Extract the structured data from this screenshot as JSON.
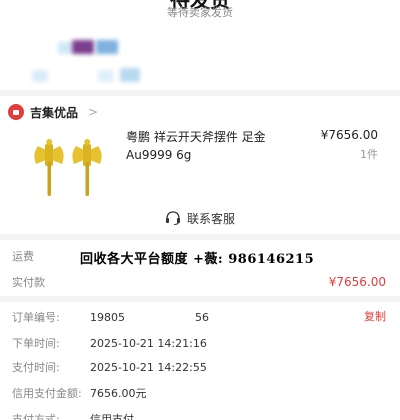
{
  "status": {
    "title": "待发货",
    "subtitle": "等待卖家发货"
  },
  "shop": {
    "name": "吉集优品",
    "arrow": ">"
  },
  "product": {
    "title": "粤鹏 祥云开天斧摆件 足金 Au9999 6g",
    "price": "¥7656.00",
    "quantity": "1件",
    "colors": {
      "gold": "#e6c22e",
      "gold_dark": "#caa21c"
    }
  },
  "service": {
    "label": "联系客服",
    "icon": "headset-icon"
  },
  "payment": {
    "shipping_label": "运费",
    "overlay_text": "回收各大平台额度 +薇: 986146215",
    "paid_label": "实付款",
    "paid_amount": "¥7656.00"
  },
  "details": {
    "order_no_label": "订单编号:",
    "order_no_value": "19805",
    "order_no_tail": "56",
    "copy_label": "复制",
    "order_time_label": "下单时间:",
    "order_time_value": "2025-10-21 14:21:16",
    "pay_time_label": "支付时间:",
    "pay_time_value": "2025-10-21 14:22:55",
    "credit_label": "信用支付金额:",
    "credit_value": "7656.00元",
    "method_label": "支付方式:",
    "method_value": "信用支付"
  },
  "colors": {
    "accent_red": "#e33c3c",
    "background": "#f3f3f3",
    "card": "#ffffff"
  }
}
